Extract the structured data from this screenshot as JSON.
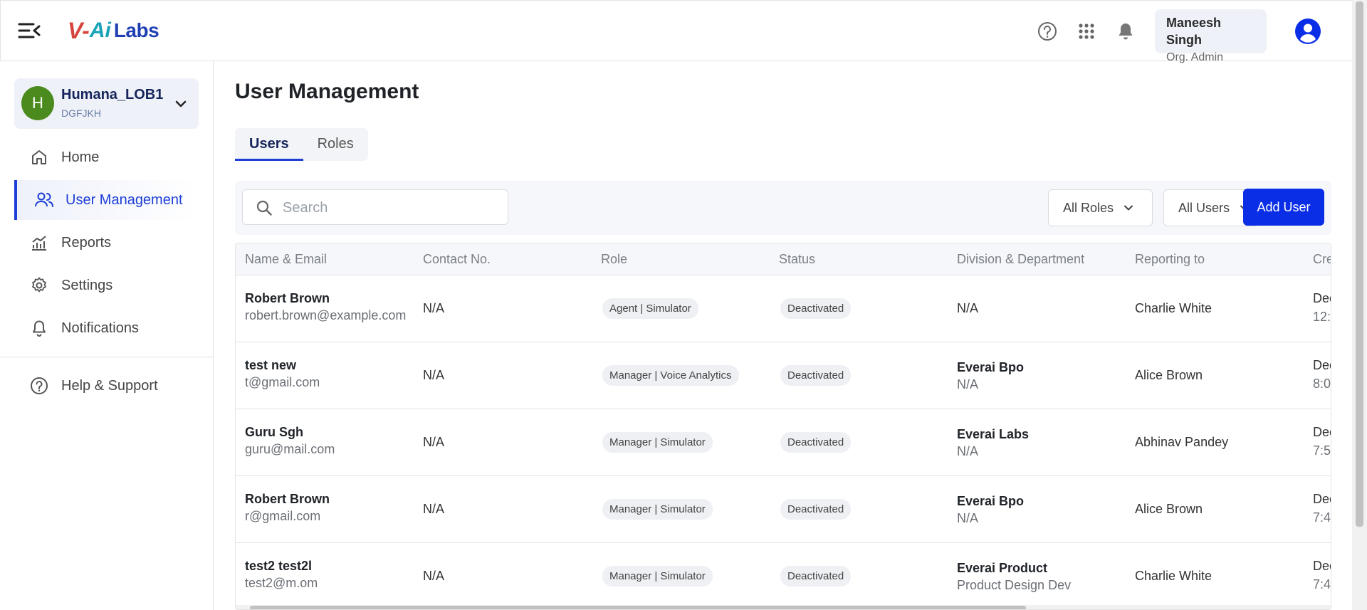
{
  "header": {
    "logo": {
      "mark": "V-",
      "ai": "Ai",
      "labs": "Labs"
    },
    "user": {
      "name": "Maneesh Singh",
      "role": "Org. Admin"
    },
    "icons": [
      "menu-collapse-icon",
      "help-icon",
      "apps-grid-icon",
      "bell-icon",
      "user-avatar-icon"
    ]
  },
  "sidebar": {
    "org": {
      "initial": "H",
      "name": "Humana_LOB1",
      "code": "DGFJKH"
    },
    "items": [
      {
        "label": "Home",
        "icon": "home-icon"
      },
      {
        "label": "User Management",
        "icon": "users-icon",
        "active": true
      },
      {
        "label": "Reports",
        "icon": "reports-chart-icon"
      },
      {
        "label": "Settings",
        "icon": "gear-icon"
      },
      {
        "label": "Notifications",
        "icon": "bell-icon"
      },
      {
        "label": "Help & Support",
        "icon": "help-icon"
      }
    ]
  },
  "main": {
    "title": "User Management",
    "tabs": [
      {
        "label": "Users",
        "active": true
      },
      {
        "label": "Roles"
      }
    ],
    "search": {
      "placeholder": "Search",
      "value": ""
    },
    "filters": {
      "roles": "All Roles",
      "users": "All Users"
    },
    "add_button": "Add User",
    "table": {
      "columns": [
        "Name & Email",
        "Contact No.",
        "Role",
        "Status",
        "Division & Department",
        "Reporting to",
        "Cre"
      ],
      "rows": [
        {
          "name": "Robert Brown",
          "email": "robert.brown@example.com",
          "contact": "N/A",
          "role": "Agent | Simulator",
          "status": "Deactivated",
          "division": "",
          "department": "N/A",
          "reporting": "Charlie White",
          "created": "Dec",
          "created_time": "12:"
        },
        {
          "name": "test new",
          "email": "t@gmail.com",
          "contact": "N/A",
          "role": "Manager | Voice Analytics",
          "status": "Deactivated",
          "division": "Everai Bpo",
          "department": "N/A",
          "reporting": "Alice Brown",
          "created": "Dec",
          "created_time": "8:0"
        },
        {
          "name": "Guru Sgh",
          "email": "guru@mail.com",
          "contact": "N/A",
          "role": "Manager | Simulator",
          "status": "Deactivated",
          "division": "Everai Labs",
          "department": "N/A",
          "reporting": "Abhinav Pandey",
          "created": "Dec",
          "created_time": "7:5"
        },
        {
          "name": "Robert Brown",
          "email": "r@gmail.com",
          "contact": "N/A",
          "role": "Manager | Simulator",
          "status": "Deactivated",
          "division": "Everai Bpo",
          "department": "N/A",
          "reporting": "Alice Brown",
          "created": "Dec",
          "created_time": "7:4"
        },
        {
          "name": "test2 test2l",
          "email": "test2@m.om",
          "contact": "N/A",
          "role": "Manager | Simulator",
          "status": "Deactivated",
          "division": "Everai Product",
          "department": "Product Design Dev",
          "reporting": "Charlie White",
          "created": "Dec",
          "created_time": "7:4"
        }
      ]
    }
  },
  "colors": {
    "primary": "#0a2ee6",
    "active_nav": "#1d3fd6",
    "org_avatar": "#4b8b1e",
    "logo_red": "#d6453d",
    "logo_teal": "#1aa3b8"
  }
}
